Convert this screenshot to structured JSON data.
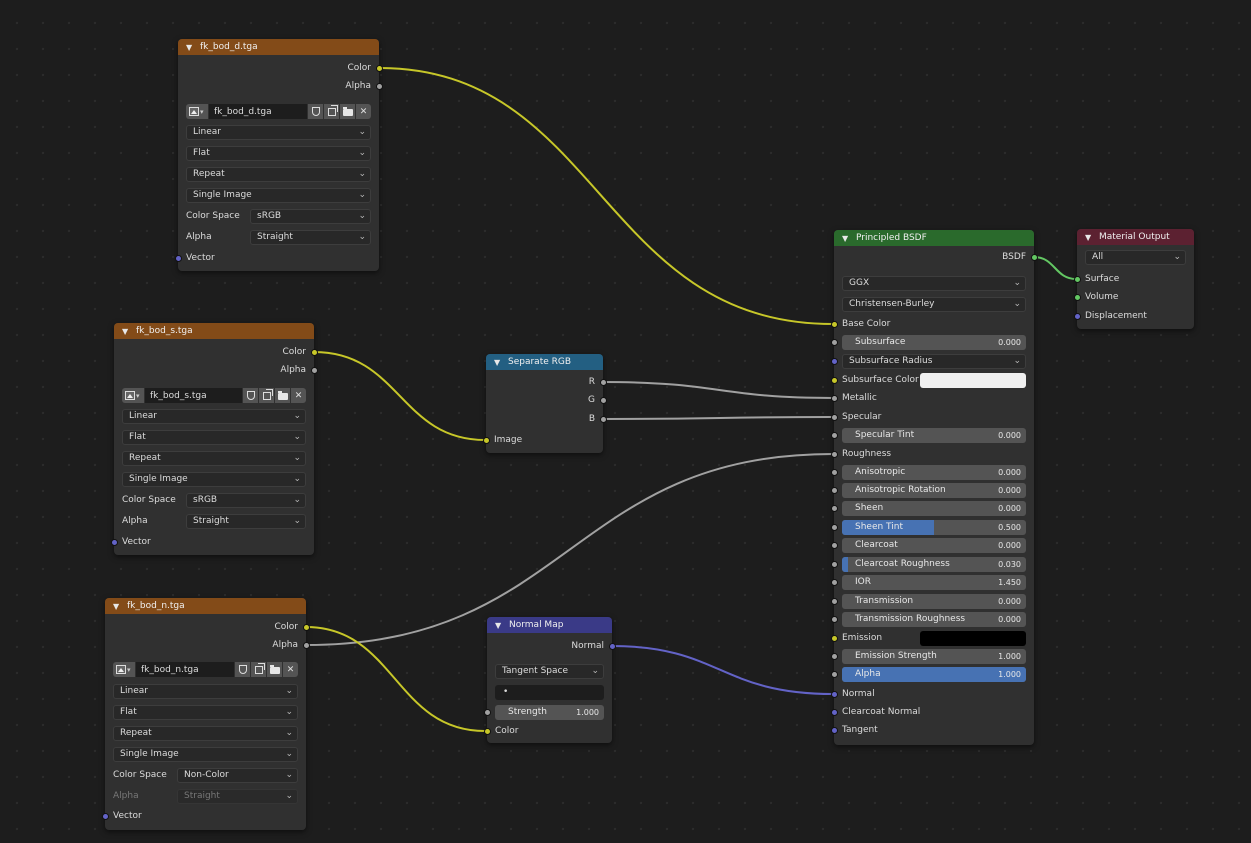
{
  "colors": {
    "background": "#1d1d1d",
    "node_body": "#303030",
    "header_image_texture": "#834b18",
    "header_shader": "#2a6a2c",
    "header_converter": "#235f82",
    "header_vector": "#3a3a87",
    "header_output": "#5c2131",
    "socket_color": "#c7c729",
    "socket_float": "#a1a1a1",
    "socket_vector": "#6363c7",
    "socket_shader": "#63c763",
    "slider_fill": "#4772b3",
    "wire_color": "#c7c729",
    "wire_float": "#a1a1a1",
    "wire_vector": "#6363c7",
    "wire_shader": "#63c763"
  },
  "icons": {
    "collapse": "chevron-down-icon",
    "image_browse": "image-icon",
    "fake_user": "shield-icon",
    "duplicate": "copy-icon",
    "open_file": "folder-icon",
    "unlink": "close-icon"
  },
  "nodes": {
    "tex_d": {
      "title": "fk_bod_d.tga",
      "outputs": {
        "color": "Color",
        "alpha": "Alpha"
      },
      "image_name": "fk_bod_d.tga",
      "interpolation": "Linear",
      "projection": "Flat",
      "extension": "Repeat",
      "source": "Single Image",
      "color_space_label": "Color Space",
      "color_space": "sRGB",
      "alpha_label": "Alpha",
      "alpha_mode": "Straight",
      "input_vector": "Vector"
    },
    "tex_s": {
      "title": "fk_bod_s.tga",
      "outputs": {
        "color": "Color",
        "alpha": "Alpha"
      },
      "image_name": "fk_bod_s.tga",
      "interpolation": "Linear",
      "projection": "Flat",
      "extension": "Repeat",
      "source": "Single Image",
      "color_space_label": "Color Space",
      "color_space": "sRGB",
      "alpha_label": "Alpha",
      "alpha_mode": "Straight",
      "input_vector": "Vector"
    },
    "tex_n": {
      "title": "fk_bod_n.tga",
      "outputs": {
        "color": "Color",
        "alpha": "Alpha"
      },
      "image_name": "fk_bod_n.tga",
      "interpolation": "Linear",
      "projection": "Flat",
      "extension": "Repeat",
      "source": "Single Image",
      "color_space_label": "Color Space",
      "color_space": "Non-Color",
      "alpha_label": "Alpha",
      "alpha_mode": "Straight",
      "input_vector": "Vector"
    },
    "separate_rgb": {
      "title": "Separate RGB",
      "outputs": {
        "r": "R",
        "g": "G",
        "b": "B"
      },
      "input_image": "Image"
    },
    "normal_map": {
      "title": "Normal Map",
      "output_normal": "Normal",
      "space": "Tangent Space",
      "uv_map": "•",
      "strength_label": "Strength",
      "strength_value": "1.000",
      "input_color": "Color"
    },
    "principled": {
      "title": "Principled BSDF",
      "output_bsdf": "BSDF",
      "distribution": "GGX",
      "subsurface_method": "Christensen-Burley",
      "base_color": "Base Color",
      "subsurface": {
        "label": "Subsurface",
        "value": "0.000",
        "fraction": 0
      },
      "subsurface_radius": "Subsurface Radius",
      "subsurface_color_label": "Subsurface Color",
      "subsurface_color": "#f0f0f0",
      "metallic": "Metallic",
      "specular": "Specular",
      "specular_tint": {
        "label": "Specular Tint",
        "value": "0.000",
        "fraction": 0
      },
      "roughness": "Roughness",
      "anisotropic": {
        "label": "Anisotropic",
        "value": "0.000",
        "fraction": 0
      },
      "anisotropic_rotation": {
        "label": "Anisotropic Rotation",
        "value": "0.000",
        "fraction": 0
      },
      "sheen": {
        "label": "Sheen",
        "value": "0.000",
        "fraction": 0
      },
      "sheen_tint": {
        "label": "Sheen Tint",
        "value": "0.500",
        "fraction": 0.5
      },
      "clearcoat": {
        "label": "Clearcoat",
        "value": "0.000",
        "fraction": 0
      },
      "clearcoat_roughness": {
        "label": "Clearcoat Roughness",
        "value": "0.030",
        "fraction": 0.03
      },
      "ior": {
        "label": "IOR",
        "value": "1.450",
        "fraction": 0
      },
      "transmission": {
        "label": "Transmission",
        "value": "0.000",
        "fraction": 0
      },
      "transmission_roughness": {
        "label": "Transmission Roughness",
        "value": "0.000",
        "fraction": 0
      },
      "emission_label": "Emission",
      "emission_color": "#000000",
      "emission_strength": {
        "label": "Emission Strength",
        "value": "1.000",
        "fraction": 0
      },
      "alpha": {
        "label": "Alpha",
        "value": "1.000",
        "fraction": 1
      },
      "normal": "Normal",
      "clearcoat_normal": "Clearcoat Normal",
      "tangent": "Tangent"
    },
    "material_output": {
      "title": "Material Output",
      "target": "All",
      "surface": "Surface",
      "volume": "Volume",
      "displacement": "Displacement"
    }
  }
}
